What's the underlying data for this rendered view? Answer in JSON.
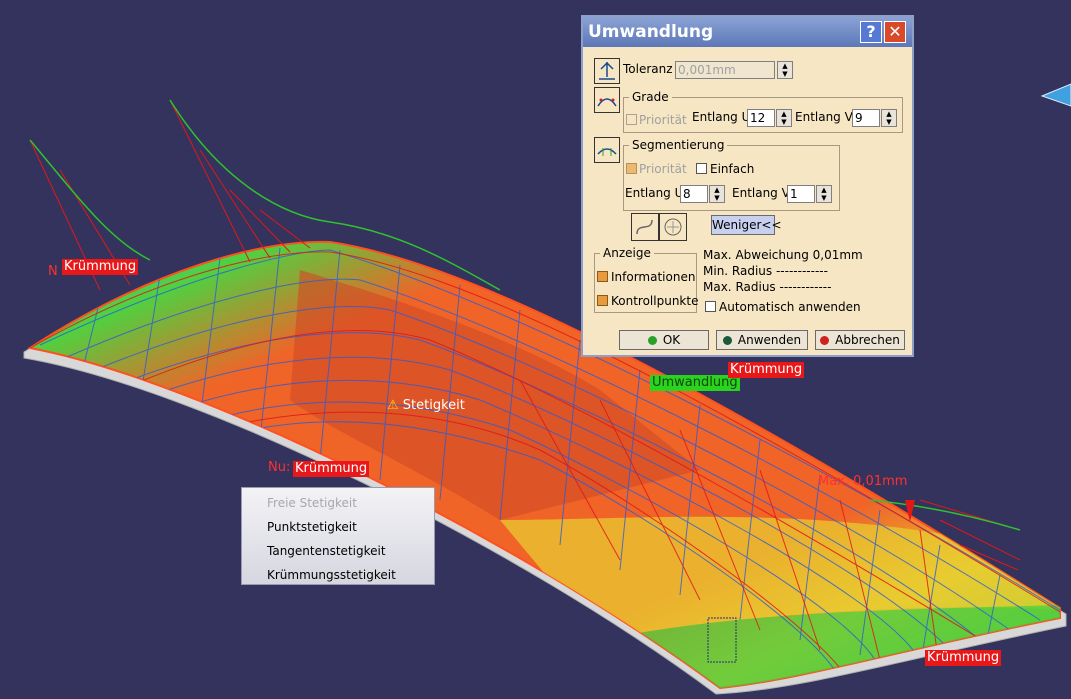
{
  "viewport_labels": {
    "kruemmung_left_prefix": "N",
    "kruemmung_left": "Krümmung",
    "kruemmung_right": "Krümmung",
    "kruemmung_mid_prefix": "Nu:",
    "kruemmung_mid": "Krümmung",
    "kruemmung_bottom": "Krümmung",
    "umwandlung_tag": "Umwandlung",
    "stetigkeit": "Stetigkeit",
    "max_abw": "Max. 0,01mm"
  },
  "dialog": {
    "title": "Umwandlung",
    "help_label": "?",
    "close_label": "✕",
    "toleranz_label": "Toleranz",
    "toleranz_value": "0,001mm",
    "grade": {
      "label": "Grade",
      "prioritaet": "Priorität",
      "entlang_u_label": "Entlang U",
      "entlang_u_value": "12",
      "entlang_v_label": "Entlang V",
      "entlang_v_value": "9"
    },
    "segmentierung": {
      "label": "Segmentierung",
      "prioritaet": "Priorität",
      "einfach": "Einfach",
      "entlang_u_label": "Entlang U",
      "entlang_u_value": "8",
      "entlang_v_label": "Entlang V",
      "entlang_v_value": "1"
    },
    "weniger_button": "Weniger<<",
    "anzeige": {
      "label": "Anzeige",
      "informationen": "Informationen",
      "kontrollpunkte": "Kontrollpunkte"
    },
    "info": {
      "max_abweichung": "Max. Abweichung 0,01mm",
      "min_radius": "Min. Radius ------------",
      "max_radius": "Max. Radius ------------",
      "auto_apply": "Automatisch anwenden"
    },
    "buttons": {
      "ok": "OK",
      "anwenden": "Anwenden",
      "abbrechen": "Abbrechen"
    }
  },
  "context_menu": {
    "items": [
      {
        "label": "Freie Stetigkeit",
        "enabled": false
      },
      {
        "label": "Punktstetigkeit",
        "enabled": true
      },
      {
        "label": "Tangentenstetigkeit",
        "enabled": true
      },
      {
        "label": "Krümmungsstetigkeit",
        "enabled": true
      }
    ]
  },
  "colors": {
    "background": "#33335e",
    "surface_orange": "#f06428",
    "surface_yellow": "#e8d030",
    "surface_green": "#40d040",
    "mesh_blue": "#2a5cd8",
    "comb_red": "#e01818",
    "comb_green": "#30c030",
    "dialog_bg": "#f6e6c4",
    "titlebar": "#6d88c4"
  }
}
